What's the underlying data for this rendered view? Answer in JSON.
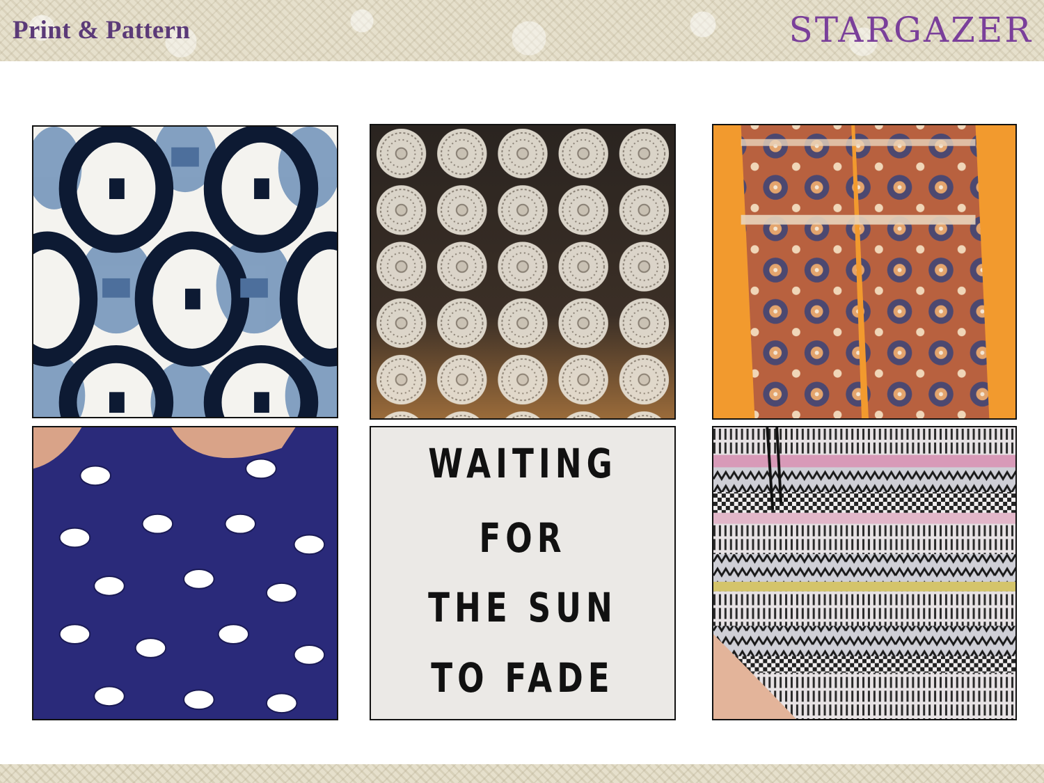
{
  "header": {
    "title": "Print & Pattern",
    "brand": "STARGAZER"
  },
  "colors": {
    "title": "#5b3a78",
    "brand": "#7a3f9a",
    "band": "#e6e0cc"
  },
  "tiles": [
    {
      "name": "ikat-print-swatch"
    },
    {
      "name": "crochet-lace-swatch"
    },
    {
      "name": "paisley-pants-swatch"
    },
    {
      "name": "elephant-print-top-swatch"
    },
    {
      "name": "slogan-tee-swatch",
      "slogan_lines": [
        "WAITING",
        "FOR",
        "THE SUN",
        "TO FADE"
      ]
    },
    {
      "name": "aztec-stripe-shorts-swatch"
    }
  ]
}
